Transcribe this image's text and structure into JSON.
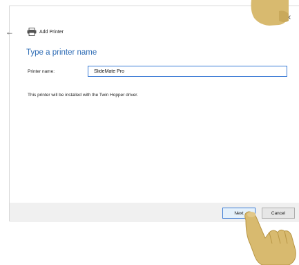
{
  "window": {
    "close_glyph": "×",
    "back_glyph": "←",
    "title": "Add Printer"
  },
  "main": {
    "heading": "Type a printer name",
    "printer_name_label": "Printer name:",
    "printer_name_value": "SlideMate Pro",
    "info_text": "This printer will be installed with the Twin Hopper driver."
  },
  "footer": {
    "next_label": "Next",
    "cancel_label": "Cancel"
  },
  "icons": {
    "printer": "printer-icon",
    "close": "close-icon",
    "back": "back-arrow-icon",
    "pointer": "hand-pointer-icon"
  },
  "colors": {
    "accent": "#2e6cb5",
    "focus_border": "#3a7bd5",
    "footer_bg": "#f0f0f0",
    "hand": "#d8ba6f"
  }
}
